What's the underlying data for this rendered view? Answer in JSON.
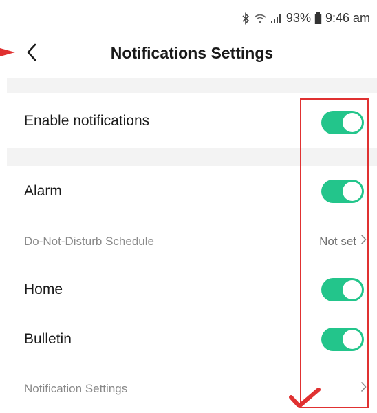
{
  "status_bar": {
    "battery": "93%",
    "time": "9:46 am",
    "icons": [
      "bluetooth-icon",
      "wifi-icon",
      "signal-icon",
      "battery-icon"
    ]
  },
  "header": {
    "title": "Notifications Settings",
    "back_icon": "chevron-left-icon"
  },
  "settings": {
    "enable_notifications": {
      "label": "Enable notifications",
      "on": true
    },
    "alarm": {
      "label": "Alarm",
      "on": true
    },
    "dnd_schedule": {
      "label": "Do-Not-Disturb Schedule",
      "value": "Not set"
    },
    "home": {
      "label": "Home",
      "on": true
    },
    "bulletin": {
      "label": "Bulletin",
      "on": true
    },
    "notification_settings": {
      "label": "Notification Settings"
    }
  },
  "colors": {
    "toggle_on": "#23c58b",
    "annotation": "#e03131",
    "section_band": "#f3f3f3"
  }
}
